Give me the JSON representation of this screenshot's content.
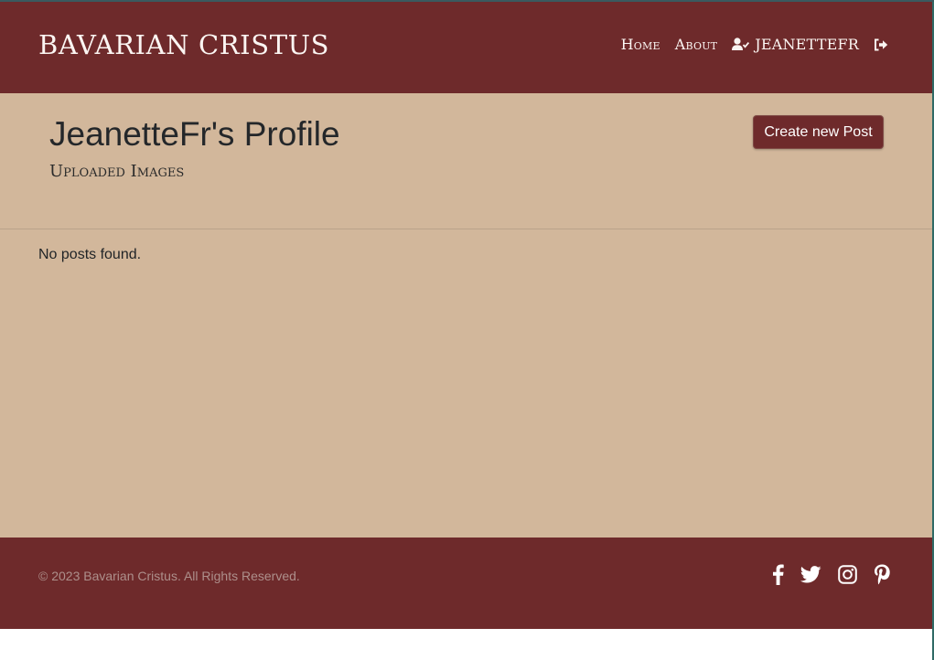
{
  "header": {
    "brand": "BAVARIAN CRISTUS",
    "nav": {
      "home": "Home",
      "about": "About",
      "user": "JEANETTEFR"
    },
    "icons": {
      "user": "user-check-icon",
      "logout": "sign-out-icon"
    }
  },
  "main": {
    "title": "JeanetteFr's Profile",
    "subtitle": "Uploaded Images",
    "create_button": "Create new Post",
    "empty_message": "No posts found."
  },
  "footer": {
    "copyright": "© 2023 Bavarian Cristus. All Rights Reserved.",
    "social_icons": [
      "facebook-icon",
      "twitter-icon",
      "instagram-icon",
      "pinterest-icon"
    ]
  },
  "colors": {
    "brand": "#6e2a2b",
    "background": "#d2b79b",
    "text_light": "#fbf5f2"
  }
}
